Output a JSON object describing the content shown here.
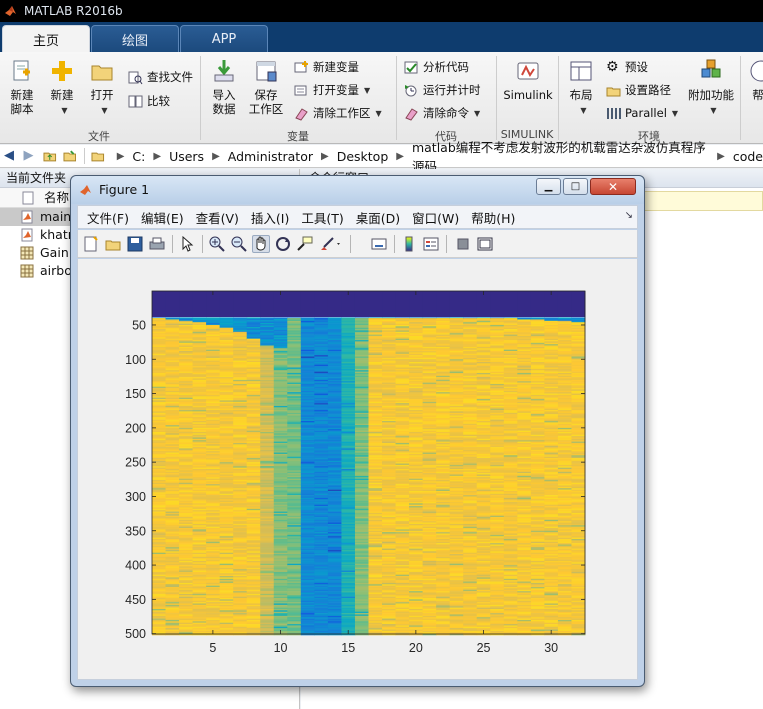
{
  "app": {
    "title": "MATLAB R2016b"
  },
  "tabs": [
    {
      "label": "主页"
    },
    {
      "label": "绘图"
    },
    {
      "label": "APP"
    }
  ],
  "ribbon": {
    "file": {
      "group_label": "文件",
      "new_script": "新建\n脚本",
      "new": "新建",
      "open": "打开",
      "find_files": "查找文件",
      "compare": "比较"
    },
    "variable": {
      "group_label": "变量",
      "import_data": "导入\n数据",
      "save_workspace": "保存\n工作区",
      "new_variable": "新建变量",
      "open_variable": "打开变量",
      "clear_workspace": "清除工作区"
    },
    "code": {
      "group_label": "代码",
      "analyze_code": "分析代码",
      "run_and_time": "运行并计时",
      "clear_commands": "清除命令"
    },
    "simulink": {
      "group_label": "SIMULINK",
      "simulink": "Simulink"
    },
    "environment": {
      "group_label": "环境",
      "layout": "布局",
      "preferences": "预设",
      "set_path": "设置路径",
      "parallel": "Parallel",
      "addons": "附加功能",
      "help_partial": "帮"
    }
  },
  "path": {
    "segments": [
      "C:",
      "Users",
      "Administrator",
      "Desktop",
      "matlab编程不考虑发射波形的机载雷达杂波仿真程序源码",
      "code"
    ]
  },
  "current_folder": {
    "header": "当前文件夹",
    "column_name": "名称",
    "files": [
      {
        "name": "main",
        "type": "m"
      },
      {
        "name": "khatr",
        "type": "m"
      },
      {
        "name": "Gain.",
        "type": "mat"
      },
      {
        "name": "airbo",
        "type": "mat"
      }
    ]
  },
  "command_window": {
    "header": "命令行窗口"
  },
  "figure": {
    "title": "Figure 1",
    "menus": [
      "文件(F)",
      "编辑(E)",
      "查看(V)",
      "插入(I)",
      "工具(T)",
      "桌面(D)",
      "窗口(W)",
      "帮助(H)"
    ],
    "toolbar_icons": [
      "new-figure-icon",
      "open-file-icon",
      "save-icon",
      "print-icon",
      "pointer-icon",
      "zoom-in-icon",
      "zoom-out-icon",
      "pan-icon",
      "rotate-3d-icon",
      "data-cursor-icon",
      "brush-icon",
      "link-plot-icon",
      "colorbar-icon",
      "legend-icon",
      "hide-plot-tools-icon",
      "show-plot-tools-icon"
    ]
  },
  "chart_data": {
    "type": "heatmap",
    "title": "",
    "xlabel": "",
    "ylabel": "",
    "xlim": [
      0.5,
      32.5
    ],
    "ylim": [
      500,
      0.5
    ],
    "x_ticks": [
      5,
      10,
      15,
      20,
      25,
      30
    ],
    "y_ticks": [
      50,
      100,
      150,
      200,
      250,
      300,
      350,
      400,
      450,
      500
    ],
    "columns": 32,
    "rows": 500,
    "colormap": "parula",
    "colormap_stops": [
      "#352a87",
      "#0f5cdd",
      "#1481d6",
      "#06a4ca",
      "#2eb7a4",
      "#87bf77",
      "#d1bb59",
      "#fec832",
      "#f9fb0e"
    ],
    "top_band_rows": 38,
    "top_band_value": 0.0,
    "body_value_by_column": [
      0.86,
      0.86,
      0.86,
      0.86,
      0.86,
      0.86,
      0.86,
      0.86,
      0.76,
      0.62,
      0.6,
      0.28,
      0.28,
      0.28,
      0.45,
      0.62,
      0.86,
      0.86,
      0.86,
      0.86,
      0.86,
      0.86,
      0.86,
      0.86,
      0.86,
      0.86,
      0.86,
      0.86,
      0.86,
      0.86,
      0.86,
      0.86
    ],
    "clutter_edge_start_row_by_column": [
      40,
      42,
      44,
      46,
      50,
      54,
      60,
      70,
      80,
      84,
      40,
      40,
      40,
      40,
      40,
      40,
      40,
      40,
      40,
      40,
      40,
      40,
      40,
      40,
      40,
      40,
      40,
      42,
      42,
      44,
      44,
      46
    ]
  }
}
